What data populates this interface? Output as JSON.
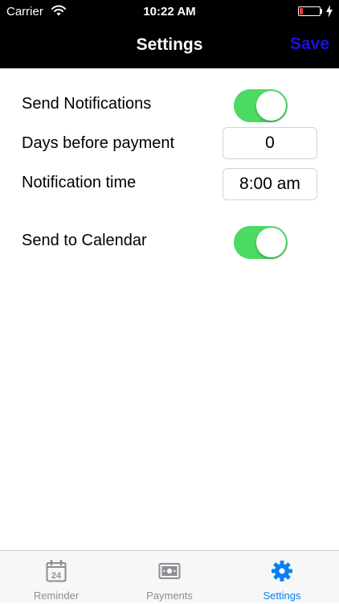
{
  "status_bar": {
    "carrier": "Carrier",
    "time": "10:22 AM",
    "battery_level": 0.15,
    "battery_color": "#ff3b30"
  },
  "nav": {
    "title": "Settings",
    "save_label": "Save",
    "save_color": "#1a10e0"
  },
  "settings": {
    "send_notifications": {
      "label": "Send Notifications",
      "on": true
    },
    "days_before_payment": {
      "label": "Days before payment",
      "value": "0"
    },
    "notification_time": {
      "label": "Notification time",
      "value": "8:00 am"
    },
    "send_to_calendar": {
      "label": "Send to Calendar",
      "on": true
    }
  },
  "colors": {
    "toggle_on": "#4cd964",
    "tab_active": "#0a7ff5",
    "tab_inactive": "#8e8e93"
  },
  "tabs": [
    {
      "label": "Reminder",
      "icon": "calendar-icon",
      "icon_text": "24",
      "active": false
    },
    {
      "label": "Payments",
      "icon": "banknote-icon",
      "active": false
    },
    {
      "label": "Settings",
      "icon": "gear-icon",
      "active": true
    }
  ]
}
